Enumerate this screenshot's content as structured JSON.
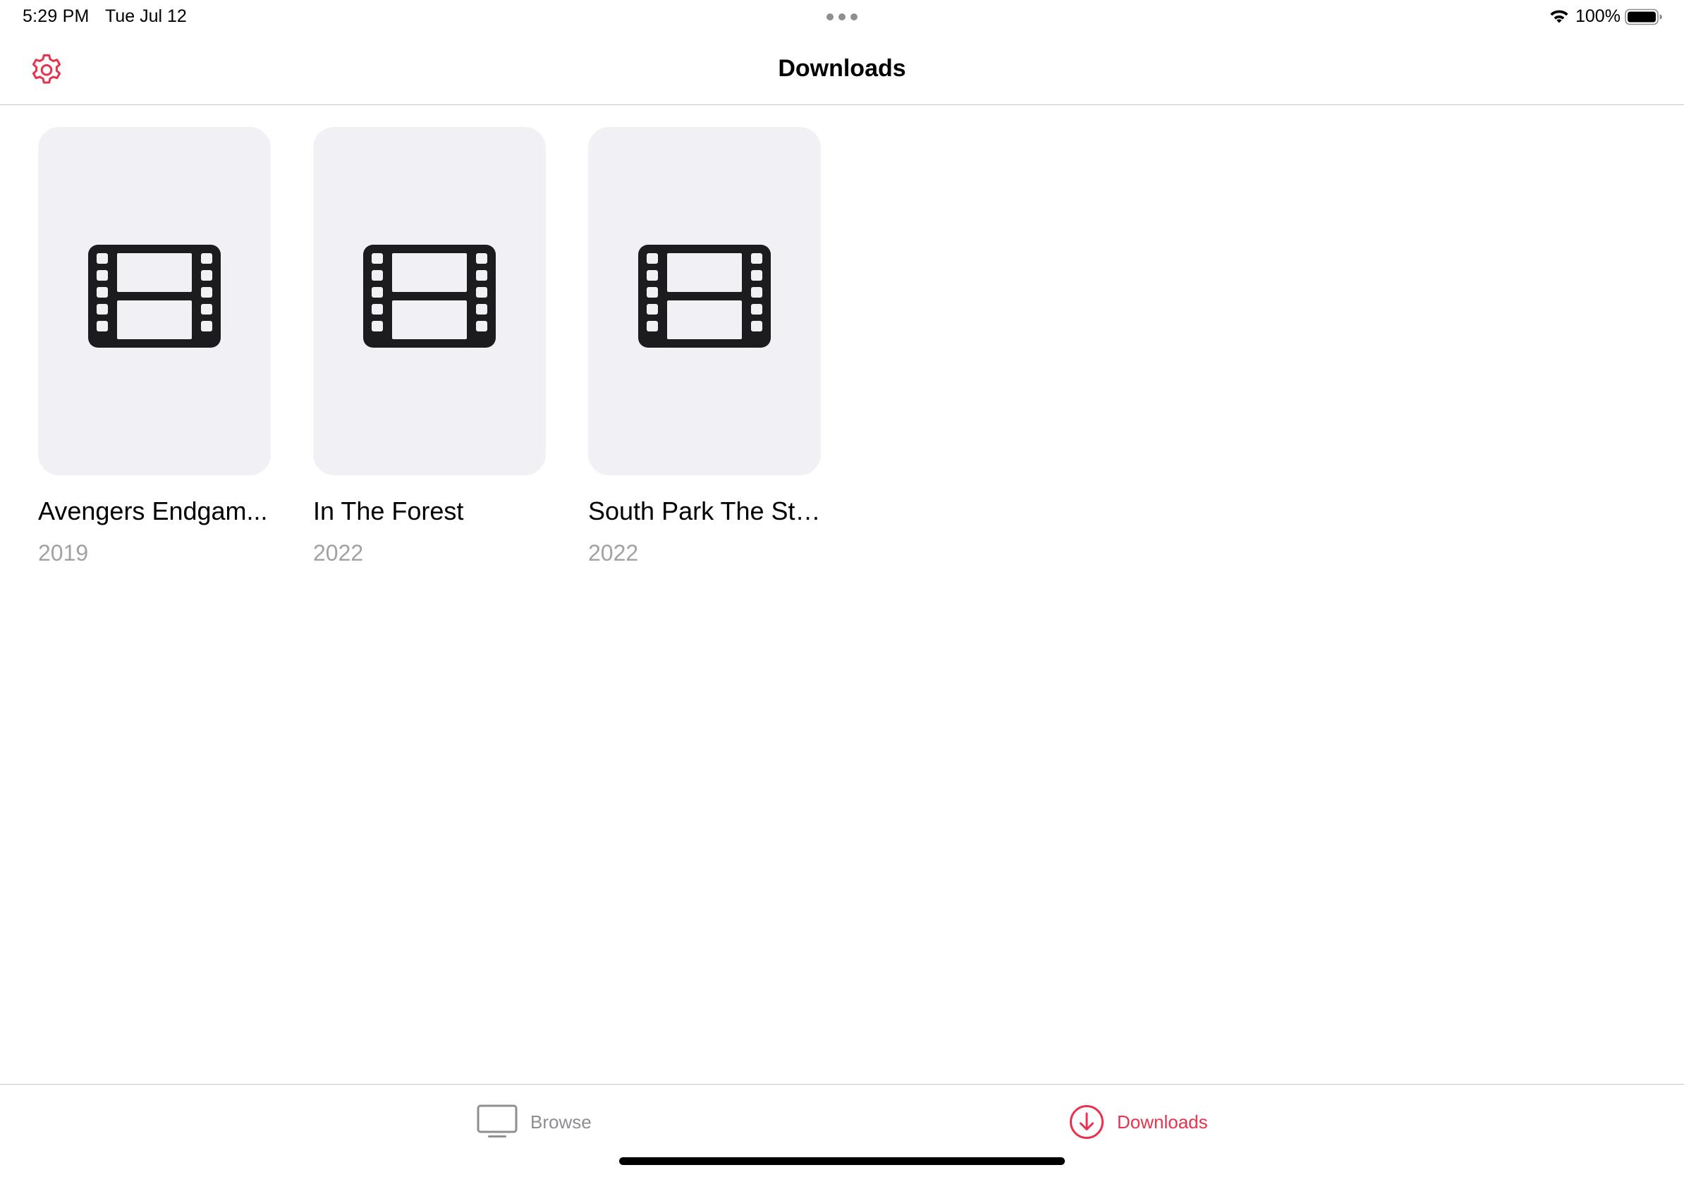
{
  "status_bar": {
    "time": "5:29 PM",
    "date": "Tue Jul 12",
    "battery": "100%"
  },
  "nav": {
    "title": "Downloads",
    "settings_icon": "gear-icon"
  },
  "downloads": [
    {
      "title": "Avengers Endgam...",
      "year": "2019",
      "icon": "film-icon"
    },
    {
      "title": "In The Forest",
      "year": "2022",
      "icon": "film-icon"
    },
    {
      "title": "South Park The Str...",
      "year": "2022",
      "icon": "film-icon"
    }
  ],
  "tabs": [
    {
      "label": "Browse",
      "icon": "tv-icon",
      "selected": false
    },
    {
      "label": "Downloads",
      "icon": "download-icon",
      "selected": true
    }
  ],
  "colors": {
    "accent": "#e8334f",
    "inactive": "#8e8e93",
    "poster_bg": "#f1f1f5",
    "secondary_text": "#a1a1a6"
  }
}
